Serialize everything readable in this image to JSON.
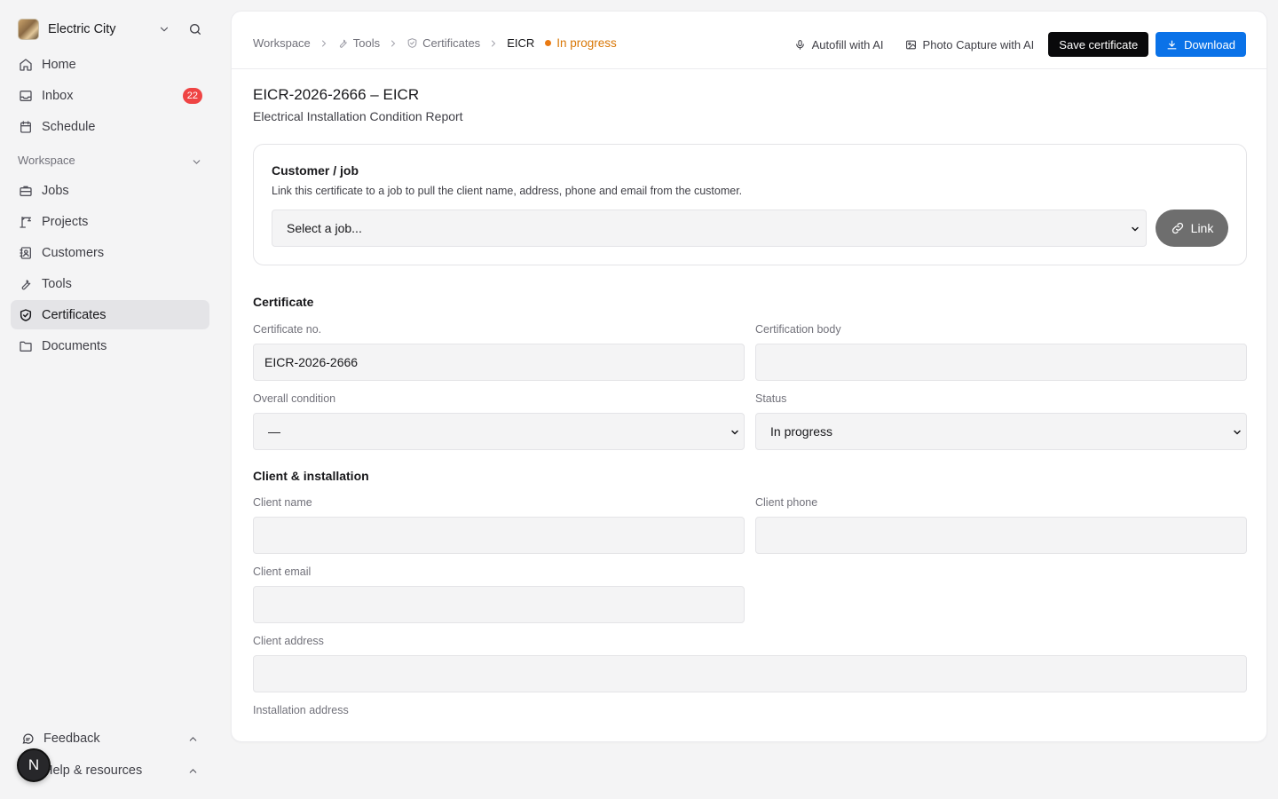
{
  "sidebar": {
    "org_name": "Electric City",
    "nav": [
      {
        "label": "Home",
        "icon": "home-icon"
      },
      {
        "label": "Inbox",
        "icon": "inbox-icon",
        "badge": "22"
      },
      {
        "label": "Schedule",
        "icon": "calendar-icon"
      }
    ],
    "workspace_label": "Workspace",
    "workspace_items": [
      {
        "label": "Jobs",
        "icon": "briefcase-icon"
      },
      {
        "label": "Projects",
        "icon": "crane-icon"
      },
      {
        "label": "Customers",
        "icon": "contacts-icon"
      },
      {
        "label": "Tools",
        "icon": "wrench-icon"
      },
      {
        "label": "Certificates",
        "icon": "shield-check-icon",
        "active": true
      },
      {
        "label": "Documents",
        "icon": "folder-icon"
      }
    ],
    "footer": {
      "feedback": "Feedback",
      "help": "Help & resources",
      "avatar_letter": "N"
    }
  },
  "header": {
    "breadcrumbs": [
      "Workspace",
      "Tools",
      "Certificates",
      "EICR"
    ],
    "status": "In progress",
    "autofill_label": "Autofill with AI",
    "photo_label": "Photo Capture with AI",
    "save_label": "Save certificate",
    "download_label": "Download"
  },
  "document": {
    "title": "EICR-2026-2666 – EICR",
    "subtitle": "Electrical Installation Condition Report"
  },
  "customer_card": {
    "title": "Customer / job",
    "description": "Link this certificate to a job to pull the client name, address, phone and email from the customer.",
    "select_value": "Select a job...",
    "link_label": "Link"
  },
  "certificate": {
    "section_title": "Certificate",
    "cert_no_label": "Certificate no.",
    "cert_no_value": "EICR-2026-2666",
    "cert_body_label": "Certification body",
    "cert_body_value": "",
    "overall_label": "Overall condition",
    "overall_value": "—",
    "status_label": "Status",
    "status_value": "In progress"
  },
  "client": {
    "section_title": "Client & installation",
    "name_label": "Client name",
    "name_value": "",
    "phone_label": "Client phone",
    "phone_value": "",
    "email_label": "Client email",
    "email_value": "",
    "address_label": "Client address",
    "address_value": "",
    "install_label": "Installation address"
  },
  "colors": {
    "accent_blue": "#0a72e8",
    "status_orange": "#d97706",
    "badge_red": "#ef4444"
  }
}
